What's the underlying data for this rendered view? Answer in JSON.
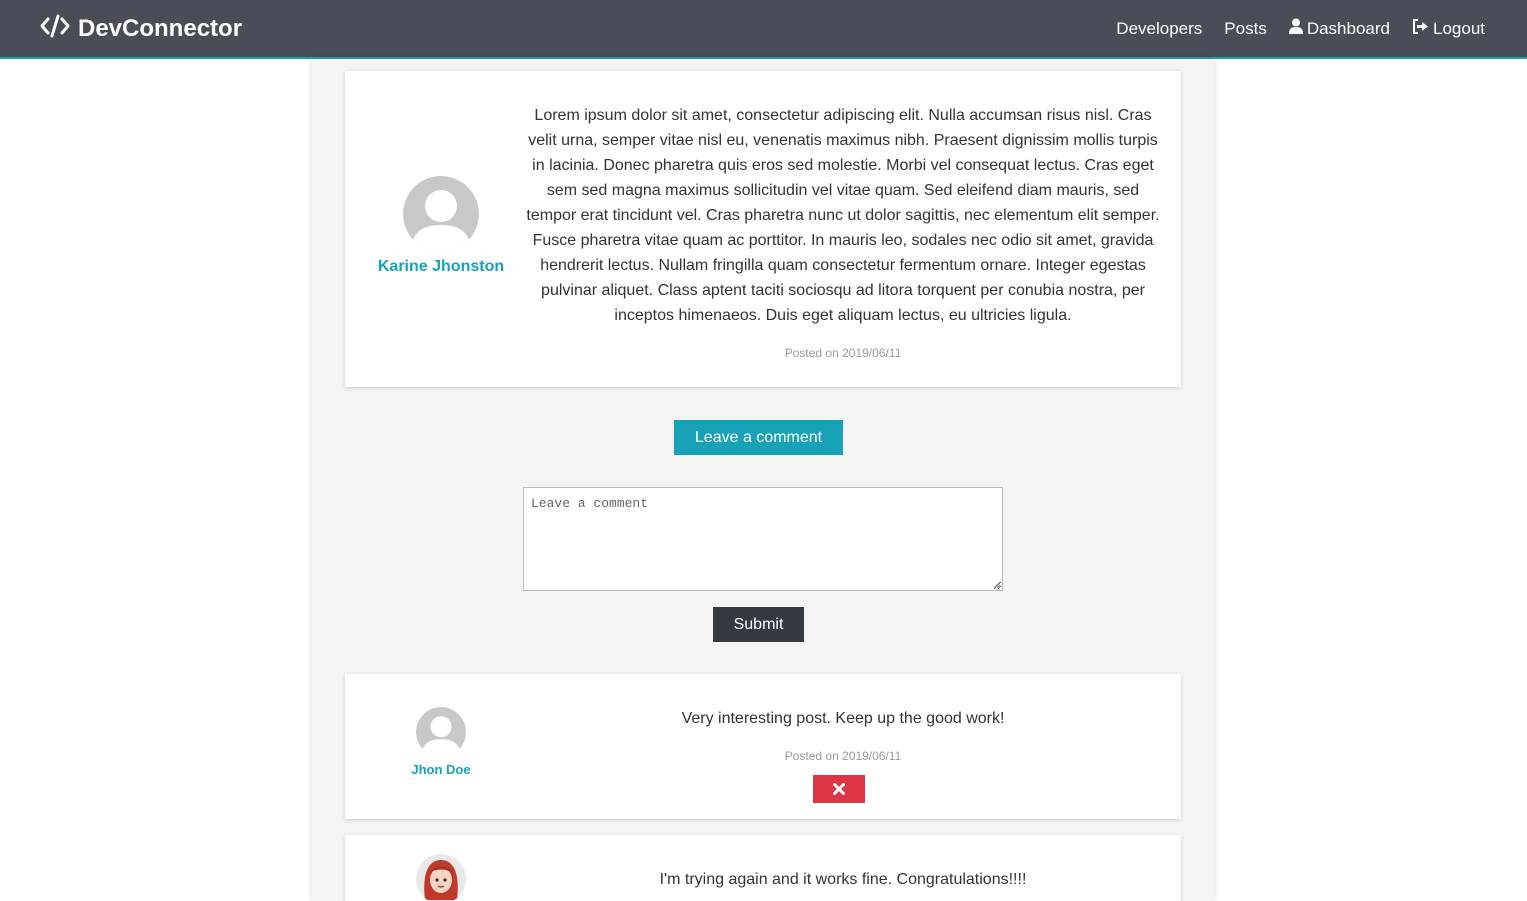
{
  "navbar": {
    "brand": "DevConnector",
    "links": [
      {
        "label": "Developers",
        "icon": ""
      },
      {
        "label": "Posts",
        "icon": ""
      },
      {
        "label": "Dashboard",
        "icon": "user-icon"
      },
      {
        "label": "Logout",
        "icon": "sign-out-icon"
      }
    ]
  },
  "post": {
    "author": "Karine Jhonston",
    "text": "Lorem ipsum dolor sit amet, consectetur adipiscing elit. Nulla accumsan risus nisl. Cras velit urna, semper vitae nisl eu, venenatis maximus nibh. Praesent dignissim mollis turpis in lacinia. Donec pharetra quis eros sed molestie. Morbi vel consequat lectus. Cras eget sem sed magna maximus sollicitudin vel vitae quam. Sed eleifend diam mauris, sed tempor erat tincidunt vel. Cras pharetra nunc ut dolor sagittis, nec elementum elit semper. Fusce pharetra vitae quam ac porttitor. In mauris leo, sodales nec odio sit amet, gravida hendrerit lectus. Nullam fringilla quam consectetur fermentum ornare. Integer egestas pulvinar aliquet. Class aptent taciti sociosqu ad litora torquent per conubia nostra, per inceptos himenaeos. Duis eget aliquam lectus, eu ultricies ligula.",
    "date": "Posted on 2019/06/11"
  },
  "comment_form": {
    "toggle_label": "Leave a comment",
    "placeholder": "Leave a comment",
    "submit_label": "Submit"
  },
  "comments": [
    {
      "author": "Jhon Doe",
      "text": "Very interesting post. Keep up the good work!",
      "date": "Posted on 2019/06/11",
      "avatar": "default-avatar"
    },
    {
      "author": "",
      "text": "I'm trying again and it works fine. Congratulations!!!!",
      "date": "",
      "avatar": "red-hair-avatar"
    }
  ],
  "colors": {
    "navbar": "#494e56",
    "accent": "#17a2b8",
    "dark": "#343a40",
    "danger": "#dc3545"
  }
}
